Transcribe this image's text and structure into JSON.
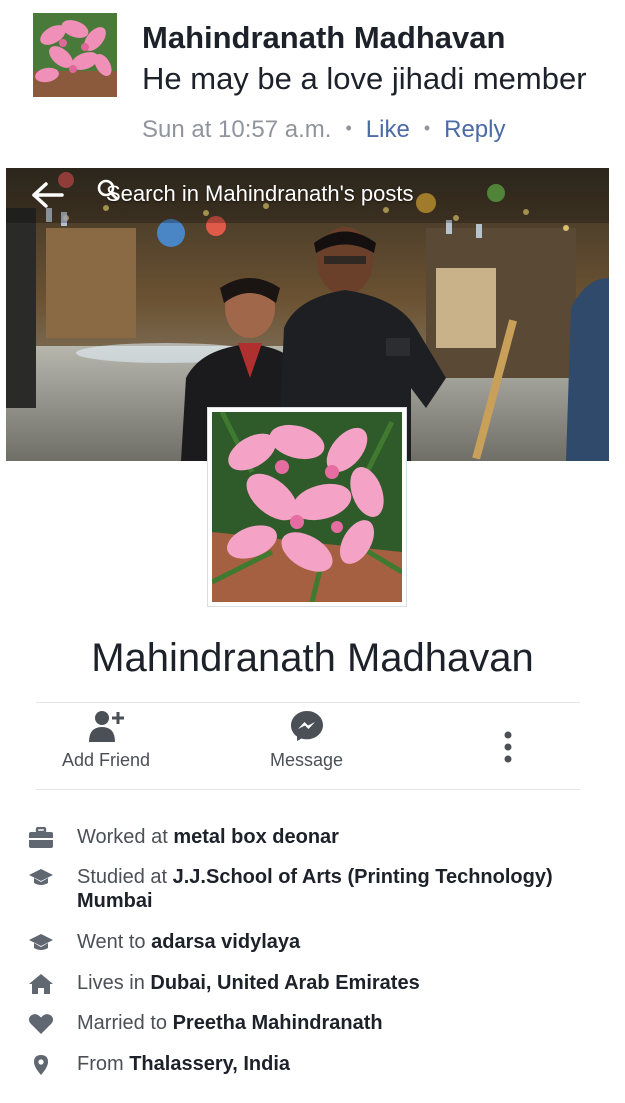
{
  "comment": {
    "author": "Mahindranath Madhavan",
    "text": "He may be a love jihadi member",
    "time": "Sun at 10:57 a.m.",
    "separator": "•",
    "like_label": "Like",
    "reply_label": "Reply"
  },
  "cover": {
    "search_placeholder": "Search in Mahindranath's posts",
    "back_icon": "back-arrow-icon",
    "search_icon": "search-icon"
  },
  "profile": {
    "name": "Mahindranath Madhavan"
  },
  "actions": [
    {
      "label": "Add Friend",
      "icon": "add-friend-icon"
    },
    {
      "label": "Message",
      "icon": "messenger-icon"
    },
    {
      "label": "",
      "icon": "more-vertical-icon"
    }
  ],
  "about": [
    {
      "prefix": "Worked at ",
      "value": "metal box deonar",
      "icon": "briefcase-icon"
    },
    {
      "prefix": "Studied at ",
      "value": "J.J.School of Arts (Printing Technology) Mumbai",
      "icon": "graduation-cap-icon"
    },
    {
      "prefix": "Went to ",
      "value": "adarsa vidylaya",
      "icon": "graduation-cap-icon"
    },
    {
      "prefix": "Lives in ",
      "value": "Dubai, United Arab Emirates",
      "icon": "home-icon"
    },
    {
      "prefix": "Married to ",
      "value": "Preetha Mahindranath",
      "icon": "heart-icon"
    },
    {
      "prefix": "From ",
      "value": "Thalassery, India",
      "icon": "location-pin-icon"
    }
  ],
  "colors": {
    "link": "#4b6ba6",
    "meta": "#90949c",
    "icon": "#606770"
  }
}
